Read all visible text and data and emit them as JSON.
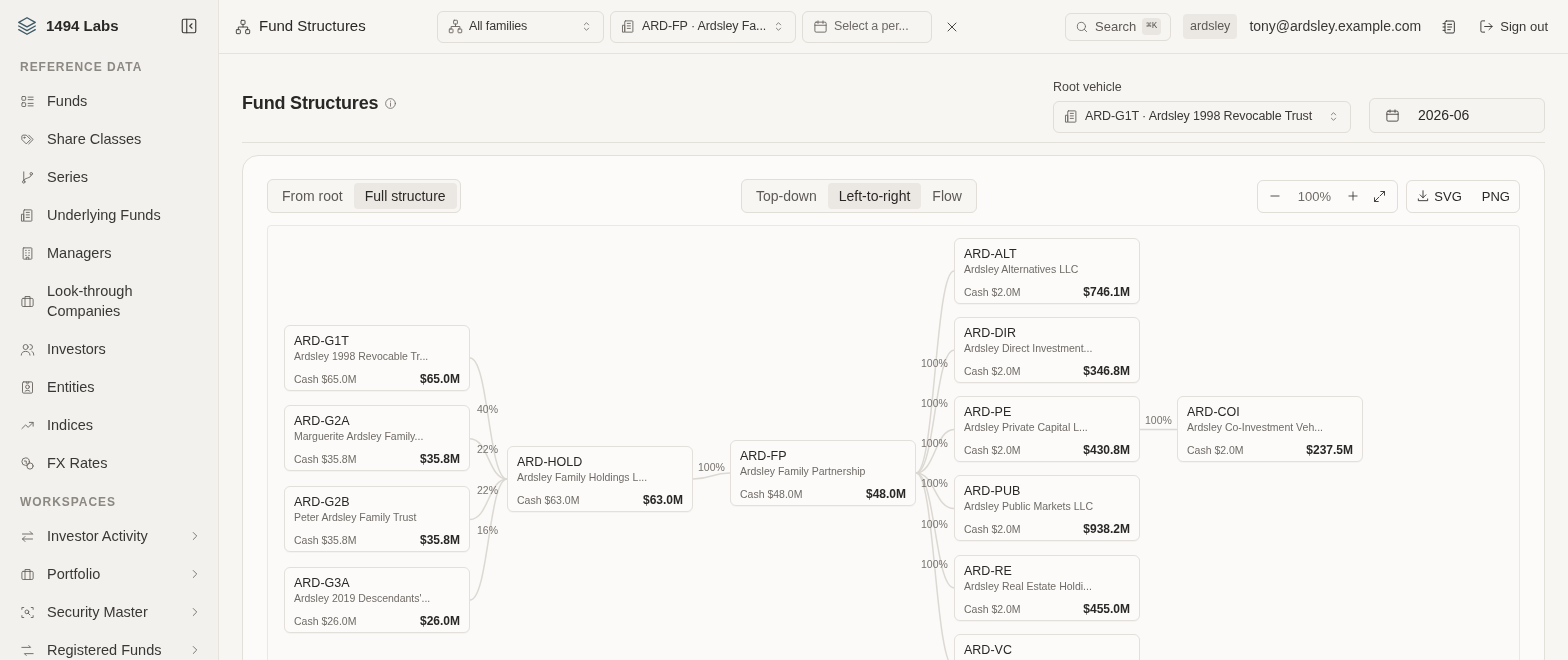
{
  "app": {
    "name": "1494 Labs"
  },
  "topbar": {
    "page_title": "Fund Structures",
    "family_select": "All families",
    "vehicle_select": "ARD-FP · Ardsley Fa...",
    "period_placeholder": "Select a per...",
    "search": {
      "label": "Search",
      "shortcut": "⌘K"
    },
    "tenant_badge": "ardsley",
    "user_email": "tony@ardsley.example.com",
    "sign_out": "Sign out"
  },
  "sidebar": {
    "sections": [
      {
        "heading": "REFERENCE DATA",
        "items": [
          {
            "label": "Funds",
            "expandable": false
          },
          {
            "label": "Share Classes",
            "expandable": false
          },
          {
            "label": "Series",
            "expandable": false
          },
          {
            "label": "Underlying Funds",
            "expandable": false
          },
          {
            "label": "Managers",
            "expandable": false
          },
          {
            "label": "Look-through Companies",
            "expandable": false
          },
          {
            "label": "Investors",
            "expandable": false
          },
          {
            "label": "Entities",
            "expandable": false
          },
          {
            "label": "Indices",
            "expandable": false
          },
          {
            "label": "FX Rates",
            "expandable": false
          }
        ]
      },
      {
        "heading": "WORKSPACES",
        "items": [
          {
            "label": "Investor Activity",
            "expandable": true
          },
          {
            "label": "Portfolio",
            "expandable": true
          },
          {
            "label": "Security Master",
            "expandable": true
          },
          {
            "label": "Registered Funds",
            "expandable": true
          }
        ]
      }
    ]
  },
  "header": {
    "title": "Fund Structures",
    "root_vehicle_label": "Root vehicle",
    "root_vehicle": "ARD-G1T · Ardsley 1998 Revocable Trust",
    "period": "2026-06"
  },
  "toolbar": {
    "scope_tabs": [
      {
        "label": "From root",
        "selected": false
      },
      {
        "label": "Full structure",
        "selected": true
      }
    ],
    "layout_tabs": [
      {
        "label": "Top-down",
        "selected": false
      },
      {
        "label": "Left-to-right",
        "selected": true
      },
      {
        "label": "Flow",
        "selected": false
      }
    ],
    "zoom": "100%",
    "exports": [
      "SVG",
      "PNG"
    ]
  },
  "diagram": {
    "owners": [
      {
        "code": "ARD-G1T",
        "name": "Ardsley 1998 Revocable Tr...",
        "cash": "Cash $65.0M",
        "total": "$65.0M",
        "share": "40%"
      },
      {
        "code": "ARD-G2A",
        "name": "Marguerite Ardsley Family...",
        "cash": "Cash $35.8M",
        "total": "$35.8M",
        "share": "22%"
      },
      {
        "code": "ARD-G2B",
        "name": "Peter Ardsley Family Trust",
        "cash": "Cash $35.8M",
        "total": "$35.8M",
        "share": "22%"
      },
      {
        "code": "ARD-G3A",
        "name": "Ardsley 2019 Descendants'...",
        "cash": "Cash $26.0M",
        "total": "$26.0M",
        "share": "16%"
      }
    ],
    "holding": {
      "code": "ARD-HOLD",
      "name": "Ardsley Family Holdings L...",
      "cash": "Cash $63.0M",
      "total": "$63.0M",
      "children": [
        {
          "code": "ARD-FP",
          "name": "Ardsley Family Partnership",
          "cash": "Cash $48.0M",
          "total": "$48.0M",
          "share": "100%",
          "children": [
            {
              "code": "ARD-ALT",
              "name": "Ardsley Alternatives LLC",
              "cash": "Cash $2.0M",
              "total": "$746.1M",
              "share": "100%"
            },
            {
              "code": "ARD-DIR",
              "name": "Ardsley Direct Investment...",
              "cash": "Cash $2.0M",
              "total": "$346.8M",
              "share": "100%"
            },
            {
              "code": "ARD-PE",
              "name": "Ardsley Private Capital L...",
              "cash": "Cash $2.0M",
              "total": "$430.8M",
              "share": "100%",
              "children": [
                {
                  "code": "ARD-COI",
                  "name": "Ardsley Co-Investment Veh...",
                  "cash": "Cash $2.0M",
                  "total": "$237.5M",
                  "share": "100%"
                }
              ]
            },
            {
              "code": "ARD-PUB",
              "name": "Ardsley Public Markets LLC",
              "cash": "Cash $2.0M",
              "total": "$938.2M",
              "share": "100%"
            },
            {
              "code": "ARD-RE",
              "name": "Ardsley Real Estate Holdi...",
              "cash": "Cash $2.0M",
              "total": "$455.0M",
              "share": "100%"
            },
            {
              "code": "ARD-VC",
              "share": "100%"
            }
          ]
        }
      ]
    }
  }
}
